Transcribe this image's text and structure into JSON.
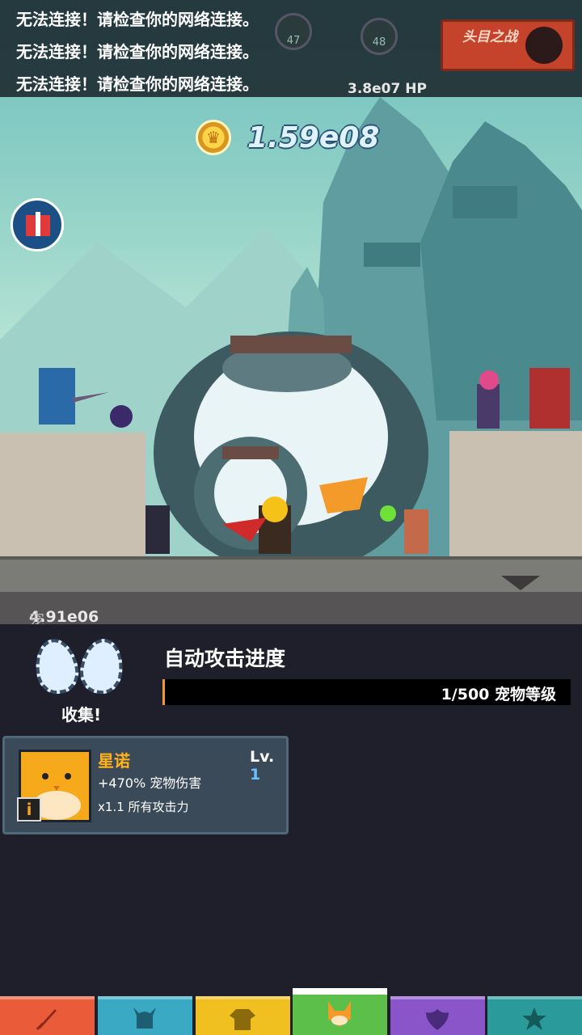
{
  "notices": [
    "无法连接！请检查你的网络连接。",
    "无法连接！请检查你的网络连接。",
    "无法连接！请检查你的网络连接。"
  ],
  "stages": {
    "current": "47",
    "next": "48"
  },
  "boss": {
    "hp": "3.8e07 HP",
    "button_label": "头目之战"
  },
  "gold": {
    "amount": "1.59e08",
    "icon": "crown-coin-icon"
  },
  "gift": {
    "icon": "gift-icon"
  },
  "pet_damage": {
    "value": "4.91e06",
    "label": "宠物伤害"
  },
  "eggs": {
    "label": "收集!"
  },
  "auto_attack": {
    "title": "自动攻击进度",
    "progress_text": "1/500 宠物等级",
    "progress_fraction": 0.002
  },
  "pet_card": {
    "name": "星诺",
    "level_prefix": "Lv.",
    "level": "1",
    "bonus": "+470% 宠物伤害",
    "attack": "x1.1 所有攻击力",
    "info_icon": "i"
  },
  "tabs": [
    {
      "name": "sword",
      "color": "#ea5b3a",
      "icon": "sword-icon"
    },
    {
      "name": "heroes",
      "color": "#3aa9c4",
      "icon": "horned-helmet-icon"
    },
    {
      "name": "equipment",
      "color": "#f0c020",
      "icon": "shirt-icon"
    },
    {
      "name": "pets",
      "color": "#5bbf4a",
      "icon": "fox-icon",
      "active": true
    },
    {
      "name": "clan",
      "color": "#8a55c9",
      "icon": "shield-wings-icon"
    },
    {
      "name": "artifacts",
      "color": "#2a9a9a",
      "icon": "star-icon"
    }
  ]
}
